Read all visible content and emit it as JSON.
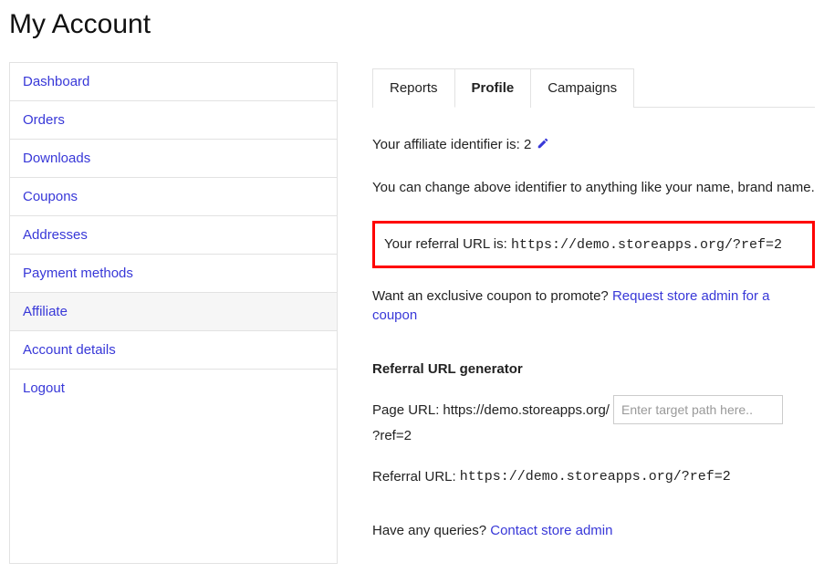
{
  "page_title": "My Account",
  "sidebar": {
    "items": [
      {
        "label": "Dashboard",
        "active": false
      },
      {
        "label": "Orders",
        "active": false
      },
      {
        "label": "Downloads",
        "active": false
      },
      {
        "label": "Coupons",
        "active": false
      },
      {
        "label": "Addresses",
        "active": false
      },
      {
        "label": "Payment methods",
        "active": false
      },
      {
        "label": "Affiliate",
        "active": true
      },
      {
        "label": "Account details",
        "active": false
      },
      {
        "label": "Logout",
        "active": false
      }
    ]
  },
  "tabs": [
    {
      "label": "Reports",
      "active": false
    },
    {
      "label": "Profile",
      "active": true
    },
    {
      "label": "Campaigns",
      "active": false
    }
  ],
  "profile": {
    "id_label": "Your affiliate identifier is:",
    "id_value": "2",
    "change_note": "You can change above identifier to anything like your name, brand name.",
    "referral_label": "Your referral URL is:",
    "referral_url": "https://demo.storeapps.org/?ref=2",
    "coupon_question": "Want an exclusive coupon to promote?",
    "coupon_link": "Request store admin for a coupon",
    "generator_title": "Referral URL generator",
    "page_url_label": "Page URL:",
    "page_url_base": "https://demo.storeapps.org/",
    "page_url_placeholder": "Enter target path here..",
    "page_url_suffix": "?ref=2",
    "gen_referral_label": "Referral URL:",
    "gen_referral_url": "https://demo.storeapps.org/?ref=2",
    "queries_label": "Have any queries?",
    "queries_link": "Contact store admin"
  }
}
